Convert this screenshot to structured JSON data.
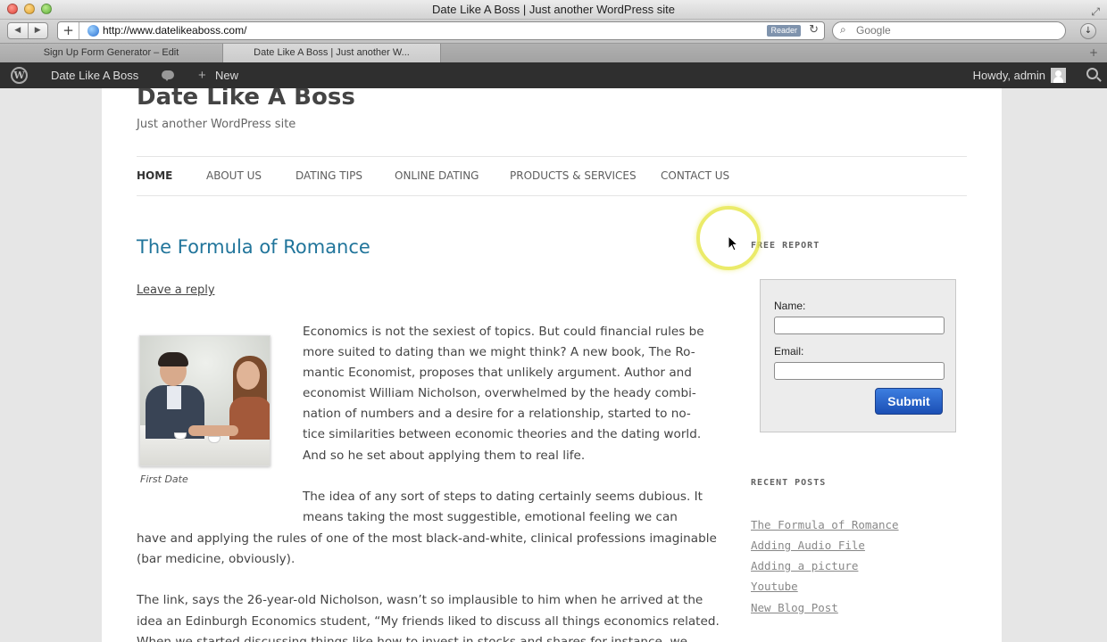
{
  "window": {
    "title": "Date Like A Boss | Just another WordPress site"
  },
  "toolbar": {
    "url": "http://www.datelikeaboss.com/",
    "reader_label": "Reader",
    "search_placeholder": "Google"
  },
  "tabs": [
    {
      "label": "Sign Up Form Generator – Edit"
    },
    {
      "label": "Date Like A Boss | Just another W..."
    }
  ],
  "adminbar": {
    "site_name": "Date Like A Boss",
    "new_label": "New",
    "howdy": "Howdy, admin"
  },
  "site": {
    "title": "Date Like A Boss",
    "description": "Just another WordPress site"
  },
  "nav": [
    {
      "label": "HOME"
    },
    {
      "label": "ABOUT US"
    },
    {
      "label": "DATING TIPS"
    },
    {
      "label": "ONLINE DATING"
    },
    {
      "label": "PRODUCTS & SERVICES"
    },
    {
      "label": "CONTACT US"
    }
  ],
  "post": {
    "title": "The Formula of Romance",
    "leave_reply": "Leave a reply",
    "image_caption": "First Date",
    "lines": [
      "Economics is not the sexiest of topics. But could financial rules be",
      "more suited to dating than we might think? A new book, The Ro-",
      "mantic Economist, proposes that unlikely argument. Author and",
      "economist William Nicholson, overwhelmed by the heady combi-",
      "nation of numbers and a desire for a relationship, started to no-",
      "tice similarities between economic theories and the dating world.",
      "And so he set about applying them to real life.",
      "The idea of any sort of steps to dating certainly seems dubious. It",
      "means taking the most suggestible, emotional feeling we can",
      "have and applying the rules of one of the most black-and-white, clinical professions imaginable",
      "(bar medicine, obviously).",
      "The link, says the 26-year-old Nicholson, wasn’t so implausible to him when he arrived at the",
      "idea an Edinburgh Economics student, “My friends liked to discuss all things economics related.",
      "When we started discussing things like how to invest in stocks and shares for instance, we"
    ]
  },
  "sidebar": {
    "free_report_title": "FREE REPORT",
    "form": {
      "name_label": "Name:",
      "email_label": "Email:",
      "submit_label": "Submit"
    },
    "recent_posts_title": "RECENT POSTS",
    "recent_posts": [
      {
        "label": "The Formula of Romance"
      },
      {
        "label": "Adding Audio File"
      },
      {
        "label": "Adding a picture"
      },
      {
        "label": "Youtube"
      },
      {
        "label": "New Blog Post"
      }
    ]
  }
}
